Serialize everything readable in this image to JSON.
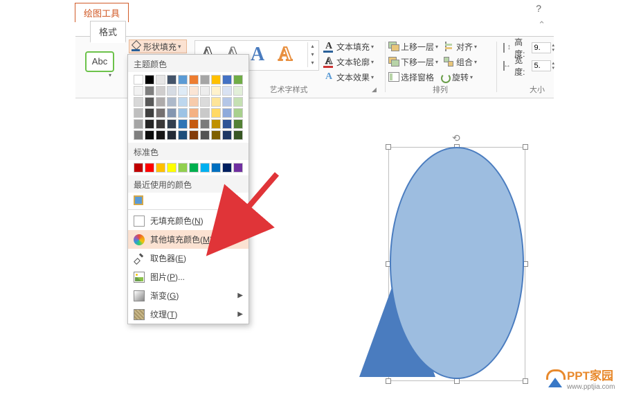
{
  "tabs": {
    "drawing_tools": "绘图工具",
    "format": "格式"
  },
  "help": "?",
  "abc": "Abc",
  "shape_fill_btn": "形状填充",
  "wordart": {
    "a1": "A",
    "a2": "A",
    "a3": "A",
    "a4": "A"
  },
  "text_fill": {
    "fill": "文本填充",
    "outline": "文本轮廓",
    "effect": "文本效果"
  },
  "arrange": {
    "front": "上移一层",
    "back": "下移一层",
    "pane": "选择窗格",
    "align": "对齐",
    "group": "组合",
    "rotate": "旋转"
  },
  "size": {
    "height_label": "高度:",
    "width_label": "宽度:",
    "height": "9.",
    "width": "5."
  },
  "group_labels": {
    "wordart": "艺术字样式",
    "arrange": "排列",
    "size": "大小"
  },
  "dropdown": {
    "theme": "主题颜色",
    "standard": "标准色",
    "recent": "最近使用的颜色",
    "no_fill": "无填充颜色(N)",
    "more_fill": "其他填充颜色(M)...",
    "eyedropper": "取色器(E)",
    "picture": "图片(P)...",
    "gradient": "渐变(G)",
    "texture": "纹理(T)"
  },
  "theme_colors": [
    [
      "#ffffff",
      "#000000",
      "#e7e6e6",
      "#44546a",
      "#5b9bd5",
      "#ed7d31",
      "#a5a5a5",
      "#ffc000",
      "#4472c4",
      "#70ad47"
    ],
    [
      "#f2f2f2",
      "#7f7f7f",
      "#d0cece",
      "#d6dce4",
      "#deebf6",
      "#fbe5d5",
      "#ededed",
      "#fff2cc",
      "#d9e2f3",
      "#e2efd9"
    ],
    [
      "#d8d8d8",
      "#595959",
      "#aeabab",
      "#adb9ca",
      "#bdd7ee",
      "#f7cbac",
      "#dbdbdb",
      "#fee599",
      "#b4c6e7",
      "#c5e0b3"
    ],
    [
      "#bfbfbf",
      "#3f3f3f",
      "#757070",
      "#8496b0",
      "#9cc3e5",
      "#f4b183",
      "#c9c9c9",
      "#ffd965",
      "#8eaadb",
      "#a8d08d"
    ],
    [
      "#a5a5a5",
      "#262626",
      "#3a3838",
      "#323f4f",
      "#2e75b5",
      "#c55a11",
      "#7b7b7b",
      "#bf9000",
      "#2f5496",
      "#538135"
    ],
    [
      "#7f7f7f",
      "#0c0c0c",
      "#171616",
      "#222a35",
      "#1e4e79",
      "#833c0b",
      "#525252",
      "#7f6000",
      "#1f3864",
      "#375623"
    ]
  ],
  "standard_colors": [
    "#c00000",
    "#ff0000",
    "#ffc000",
    "#ffff00",
    "#92d050",
    "#00b050",
    "#00b0f0",
    "#0070c0",
    "#002060",
    "#7030a0"
  ],
  "watermark": {
    "brand": "PPT家园",
    "url": "www.pptjia.com"
  }
}
